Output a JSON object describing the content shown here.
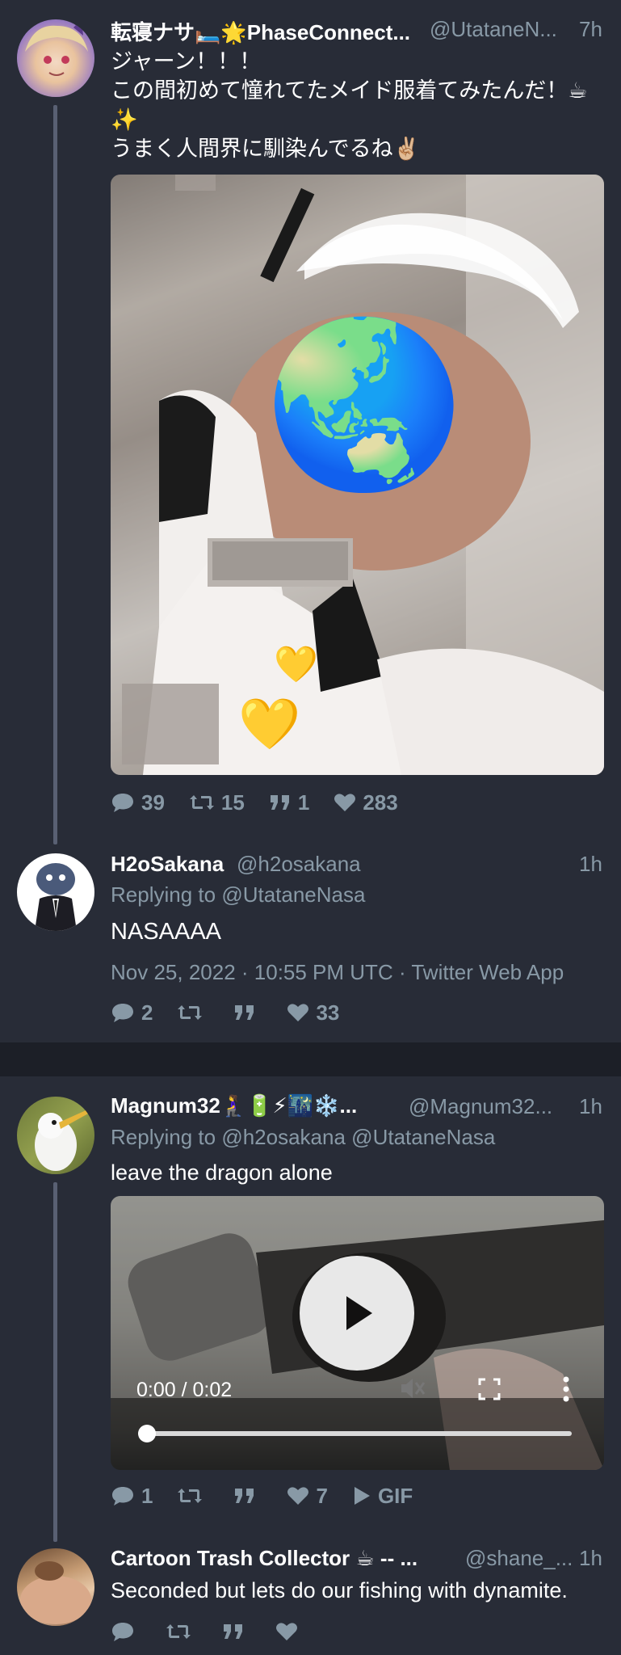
{
  "tweet1": {
    "name": "転寝ナサ🛏️🌟PhaseConnect...",
    "handle": "@UtataneN...",
    "time": "7h",
    "line1": "ジャーン！！！",
    "line2": "この間初めて憧れてたメイド服着てみたんだ！☕",
    "line3": "✨",
    "line4": "うまく人間界に馴染んでるね✌🏼",
    "replies": "39",
    "retweets": "15",
    "quotes": "1",
    "likes": "283",
    "globe_emoji": "🌏",
    "heart_emoji": "💛"
  },
  "tweet2": {
    "name": "H2oSakana",
    "handle": "@h2osakana",
    "time": "1h",
    "replying_prefix": "Replying to",
    "replying_to": "@UtataneNasa",
    "content": "NASAAAA",
    "date": "Nov 25, 2022 · 10:55 PM UTC · Twitter Web App",
    "replies": "2",
    "likes": "33"
  },
  "tweet3": {
    "name": "Magnum32🧎‍♀️🔋⚡🌃❄️...",
    "handle": "@Magnum32...",
    "time": "1h",
    "replying_prefix": "Replying to",
    "replying_to_1": "@h2osakana",
    "replying_to_2": "@UtataneNasa",
    "content": "leave the dragon alone",
    "video_time": "0:00 / 0:02",
    "video_progress": 0.0,
    "replies": "1",
    "likes": "7",
    "gif_label": "GIF"
  },
  "tweet4": {
    "name": "Cartoon Trash Collector ☕ -- ...",
    "handle": "@shane_...",
    "time": "1h",
    "content": "Seconded but lets do our fishing with dynamite."
  },
  "colors": {
    "background": "#282c37",
    "secondary_text": "#8899a6",
    "separator": "#1c1f27"
  }
}
